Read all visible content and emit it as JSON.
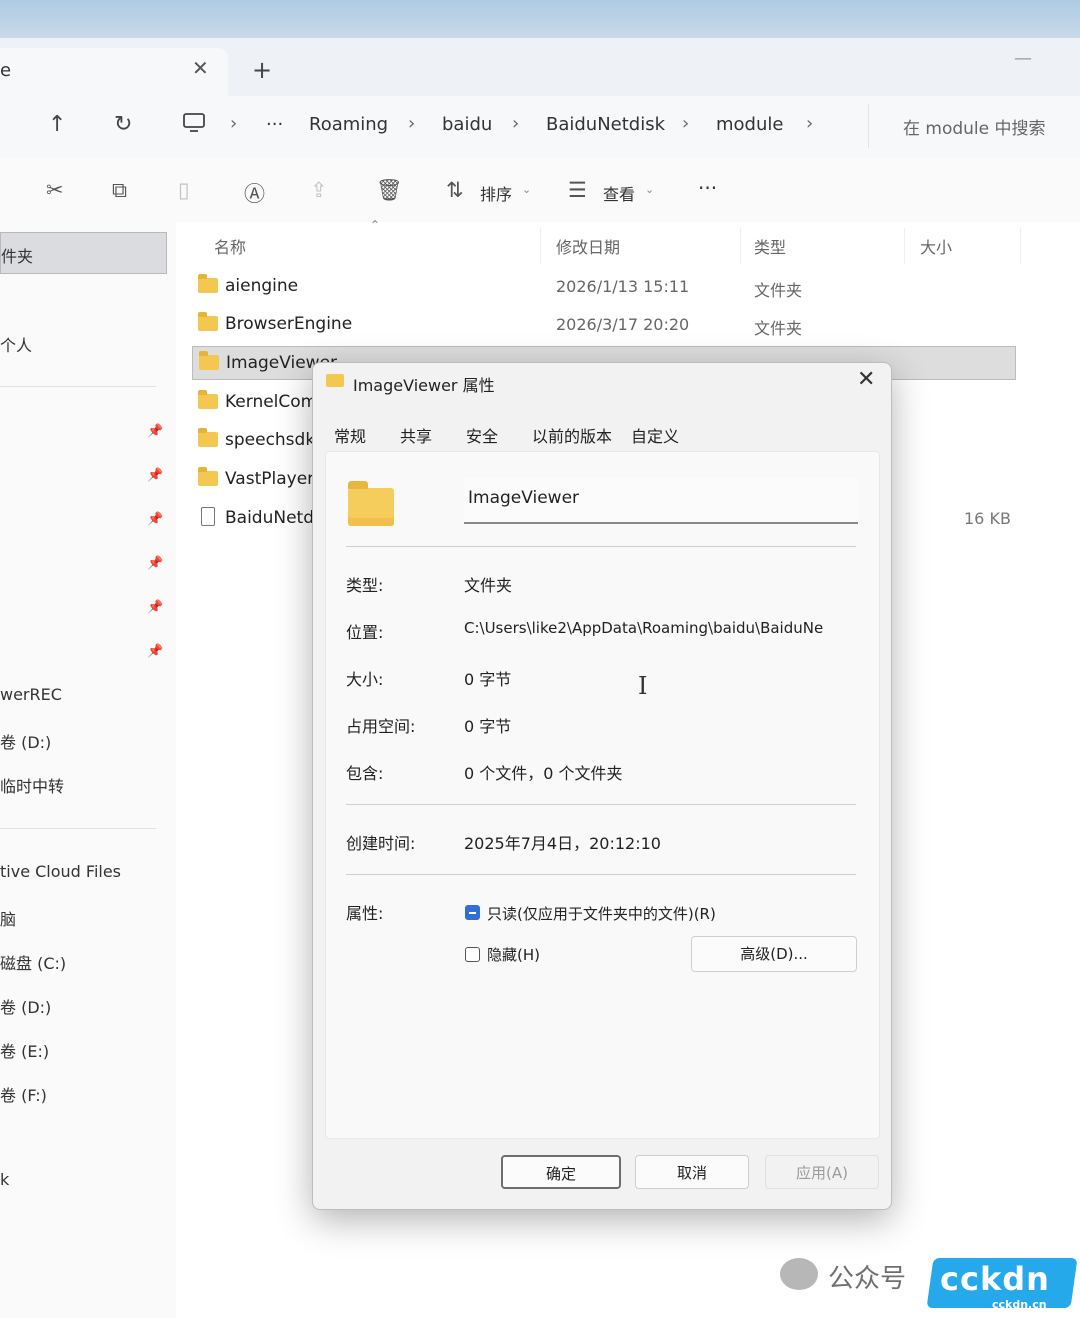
{
  "tabbar": {
    "tab_title": "e",
    "close_glyph": "✕",
    "new_tab_glyph": "+",
    "minimize_glyph": "—"
  },
  "nav": {
    "up_icon": "arrow-up-icon",
    "refresh_icon": "refresh-icon",
    "pc_icon": "computer-icon",
    "more_glyph": "···",
    "breadcrumbs": [
      "Roaming",
      "baidu",
      "BaiduNetdisk",
      "module"
    ],
    "search_placeholder": "在 module 中搜索"
  },
  "toolbar": {
    "sort_label": "排序",
    "view_label": "查看",
    "more_glyph": "···"
  },
  "sidebar": {
    "selected_label": "件夹",
    "items": [
      "个人",
      "werREC",
      "卷 (D:)",
      "临时中转",
      "tive Cloud Files",
      "脑",
      "磁盘 (C:)",
      "卷 (D:)",
      "卷 (E:)",
      "卷 (F:)",
      "k"
    ]
  },
  "columns": {
    "name": "名称",
    "modified": "修改日期",
    "type": "类型",
    "size": "大小"
  },
  "files": [
    {
      "name": "aiengine",
      "date": "2026/1/13 15:11",
      "type": "文件夹",
      "size": ""
    },
    {
      "name": "BrowserEngine",
      "date": "2026/3/17 20:20",
      "type": "文件夹",
      "size": ""
    },
    {
      "name": "ImageViewer",
      "date": "",
      "type": "",
      "size": ""
    },
    {
      "name": "KernelCom",
      "date": "",
      "type": "",
      "size": ""
    },
    {
      "name": "speechsdk",
      "date": "",
      "type": "",
      "size": ""
    },
    {
      "name": "VastPlayer",
      "date": "",
      "type": "",
      "size": ""
    },
    {
      "name": "BaiduNetd",
      "date": "",
      "type": "",
      "size": "16 KB"
    }
  ],
  "dialog": {
    "title": "ImageViewer 属性",
    "tabs": [
      "常规",
      "共享",
      "安全",
      "以前的版本",
      "自定义"
    ],
    "folder_name": "ImageViewer",
    "props": [
      {
        "label": "类型:",
        "value": "文件夹"
      },
      {
        "label": "位置:",
        "value": "C:\\Users\\like2\\AppData\\Roaming\\baidu\\BaiduNe"
      },
      {
        "label": "大小:",
        "value": "0 字节"
      },
      {
        "label": "占用空间:",
        "value": "0 字节"
      },
      {
        "label": "包含:",
        "value": "0 个文件，0 个文件夹"
      }
    ],
    "created_label": "创建时间:",
    "created_value": "2025年7月4日，20:12:10",
    "attrs_label": "属性:",
    "readonly_label": "只读(仅应用于文件夹中的文件)(R)",
    "readonly_checked": true,
    "hidden_label": "隐藏(H)",
    "hidden_checked": false,
    "advanced_label": "高级(D)...",
    "ok_label": "确定",
    "cancel_label": "取消",
    "apply_label": "应用(A)"
  },
  "watermark": {
    "text": "公众号",
    "logo_text": "cckdn",
    "logo_sub": "cckdn.cn"
  },
  "colors": {
    "accent": "#2f6fd6",
    "folder": "#f3c750",
    "selection": "#dddddd",
    "logo": "#25a9ea"
  }
}
